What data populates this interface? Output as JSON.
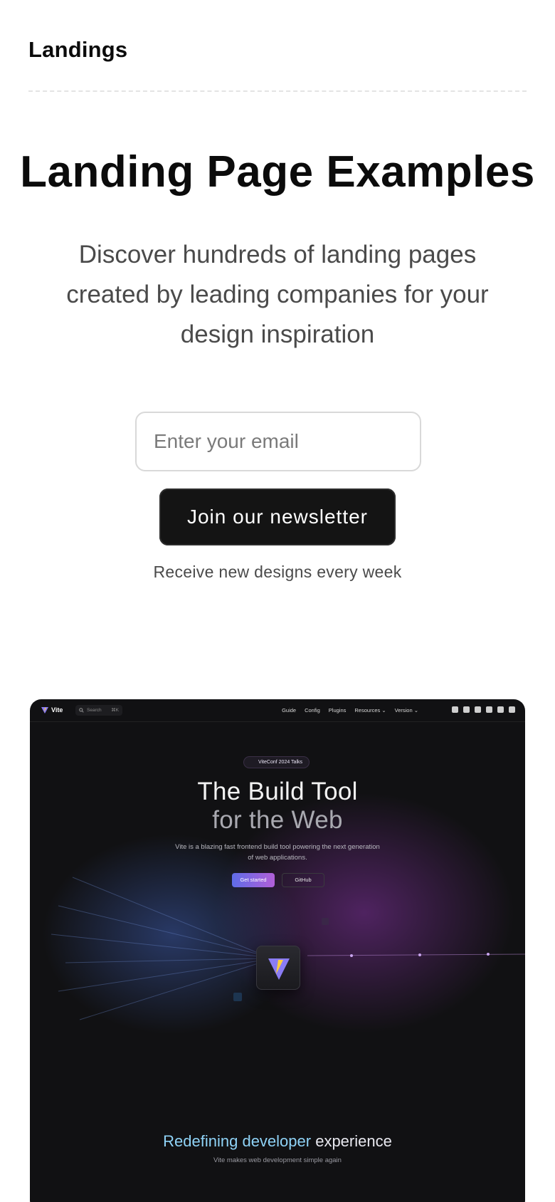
{
  "header": {
    "logo": "Landings"
  },
  "hero": {
    "title": "Landing Page Examples",
    "subtitle": "Discover hundreds of landing pages created by leading companies for your design inspiration"
  },
  "newsletter": {
    "email_placeholder": "Enter your email",
    "button_label": "Join our newsletter",
    "note": "Receive new designs every week"
  },
  "preview": {
    "nav": {
      "brand": "Vite",
      "search_placeholder": "Search",
      "search_shortcut": "⌘K",
      "links": [
        "Guide",
        "Config",
        "Plugins",
        "Resources ⌄",
        "Version ⌄"
      ],
      "icons": [
        "translate-icon",
        "bluesky-icon",
        "mastodon-icon",
        "x-icon",
        "discord-icon",
        "github-icon"
      ]
    },
    "badge": "ViteConf 2024 Talks",
    "title_line1": "The Build Tool",
    "title_line2": "for the Web",
    "description": "Vite is a blazing fast frontend build tool powering the next generation of web applications.",
    "primary_button": "Get started",
    "secondary_button": "GitHub",
    "bottom_title_highlight": "Redefining developer",
    "bottom_title_rest": " experience",
    "bottom_subtitle": "Vite makes web development simple again",
    "colors": {
      "accent_blue": "#5f6ce8",
      "accent_purple": "#b15fd8",
      "background": "#111113"
    }
  }
}
